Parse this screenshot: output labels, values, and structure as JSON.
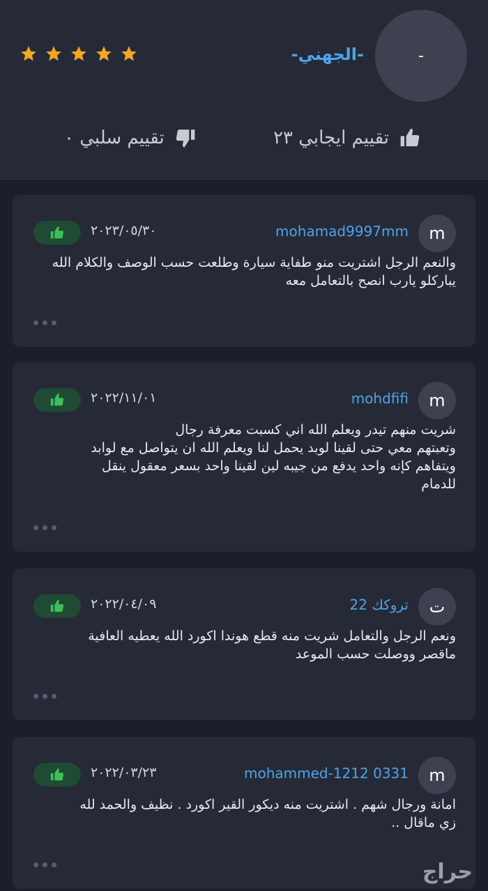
{
  "profile": {
    "avatar_initial": "-",
    "name": "-الجهني-",
    "stars": 5,
    "positive_label": "تقييم ايجابي ٢٣",
    "negative_label": "تقييم سلبي ٠",
    "star_color": "#f5a623",
    "name_color": "#4ea3e8",
    "icons": {
      "positive": "thumbs-up-icon",
      "negative": "thumbs-down-icon",
      "star": "star-icon"
    }
  },
  "reviews": [
    {
      "avatar_initial": "m",
      "username": "mohamad9997mm",
      "date": "٢٠٢٣/٠٥/٣٠",
      "text": "والنعم الرجل اشتريت منو طفاية سيارة وطلعت حسب الوصف والكلام الله\nيباركلو يارب انصح بالتعامل معه",
      "rating": "positive"
    },
    {
      "avatar_initial": "m",
      "username": "mohdfifi",
      "date": "٢٠٢٢/١١/٠١",
      "text": "شريت منهم تيدر ويعلم الله اني كسبت معرفة رجال\nوتعبتهم معي حتى لقينا لوبد يحمل لنا ويعلم الله ان يتواصل مع لوابد\nويتفاهم كإنه واحد  يدفع من جيبه لين لقينا واحد بسعر معقول ينقل\nللدمام",
      "rating": "positive"
    },
    {
      "avatar_initial": "ت",
      "username": "تروكك 22",
      "date": "٢٠٢٢/٠٤/٠٩",
      "text": "ونعم الرجل والتعامل    شريت منه قطع هوندا اكورد الله يعطيه العافية\nماقصر ووصلت حسب الموعد",
      "rating": "positive"
    },
    {
      "avatar_initial": "m",
      "username": "mohammed-1212 0331",
      "date": "٢٠٢٢/٠٣/٢٣",
      "text": "امانة ورجال شهم . اشتريت منه ديكور القير اكورد . نظيف والحمد لله\nزي ماقال ..",
      "rating": "positive"
    }
  ],
  "watermark": "حراج",
  "colors": {
    "background": "#1c1f2a",
    "card": "#262a37",
    "accent": "#4ea3e8",
    "positive_badge": "#1f4a33",
    "positive_icon": "#3fbf5a"
  }
}
